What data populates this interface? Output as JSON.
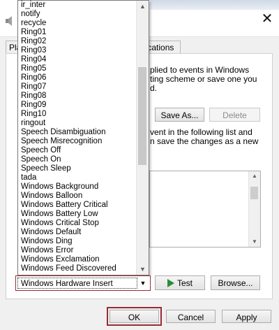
{
  "window": {
    "tabs": {
      "first_label": "Pla",
      "last_label": "nications"
    }
  },
  "panel": {
    "description_lines": [
      "plied to events in Windows",
      "ting scheme or save one you",
      "d."
    ],
    "save_as_label": "Save As...",
    "delete_label": "Delete",
    "events_lines": [
      "vent in the following list and",
      "n save the changes as a new"
    ]
  },
  "sound_list": {
    "items": [
      "ir_inter",
      "notify",
      "recycle",
      "Ring01",
      "Ring02",
      "Ring03",
      "Ring04",
      "Ring05",
      "Ring06",
      "Ring07",
      "Ring08",
      "Ring09",
      "Ring10",
      "ringout",
      "Speech Disambiguation",
      "Speech Misrecognition",
      "Speech Off",
      "Speech On",
      "Speech Sleep",
      "tada",
      "Windows Background",
      "Windows Balloon",
      "Windows Battery Critical",
      "Windows Battery Low",
      "Windows Critical Stop",
      "Windows Default",
      "Windows Ding",
      "Windows Error",
      "Windows Exclamation",
      "Windows Feed Discovered"
    ],
    "selected_value": "Windows Hardware Insert",
    "scroll": {
      "up_icon": "chevron-up-icon",
      "down_icon": "chevron-down-icon"
    }
  },
  "buttons": {
    "test_label": "Test",
    "browse_label": "Browse...",
    "ok_label": "OK",
    "cancel_label": "Cancel",
    "apply_label": "Apply"
  },
  "colors": {
    "highlight_border": "#9b2a35",
    "play_icon": "#2d8b3a"
  }
}
